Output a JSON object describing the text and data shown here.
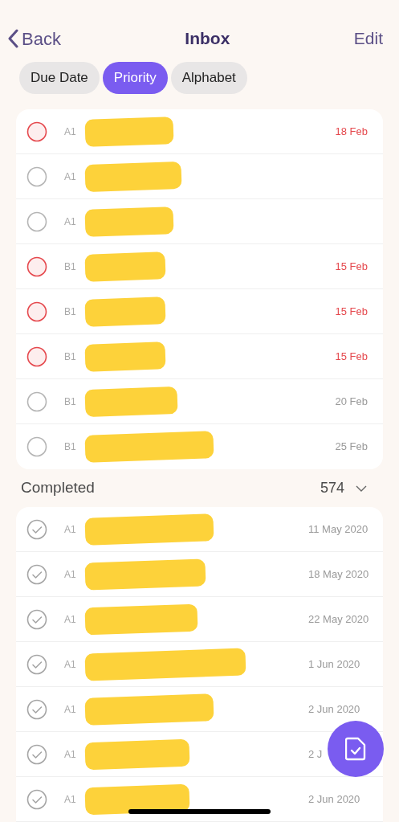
{
  "nav": {
    "back": "Back",
    "title": "Inbox",
    "edit": "Edit"
  },
  "sort_tabs": [
    {
      "label": "Due Date",
      "selected": false
    },
    {
      "label": "Priority",
      "selected": true
    },
    {
      "label": "Alphabet",
      "selected": false
    }
  ],
  "tasks": [
    {
      "priority": "A1",
      "date": "18 Feb",
      "overdue": true
    },
    {
      "priority": "A1",
      "overdue": false
    },
    {
      "priority": "A1",
      "overdue": false
    },
    {
      "priority": "B1",
      "date": "15 Feb",
      "overdue": true
    },
    {
      "priority": "B1",
      "date": "15 Feb",
      "overdue": true
    },
    {
      "priority": "B1",
      "date": "15 Feb",
      "overdue": true
    },
    {
      "priority": "B1",
      "date": "20 Feb",
      "overdue": false
    },
    {
      "priority": "B1",
      "date": "25 Feb",
      "overdue": false
    }
  ],
  "completed": {
    "title": "Completed",
    "count": "574",
    "expanded": true,
    "tasks": [
      {
        "priority": "A1",
        "date": "11 May 2020"
      },
      {
        "priority": "A1",
        "date": "18 May 2020"
      },
      {
        "priority": "A1",
        "date": "22 May 2020"
      },
      {
        "priority": "A1",
        "date": "1 Jun 2020"
      },
      {
        "priority": "A1",
        "date": "2 Jun 2020"
      },
      {
        "priority": "A1",
        "date": "2 J"
      },
      {
        "priority": "A1",
        "date": "2 Jun 2020"
      }
    ]
  }
}
